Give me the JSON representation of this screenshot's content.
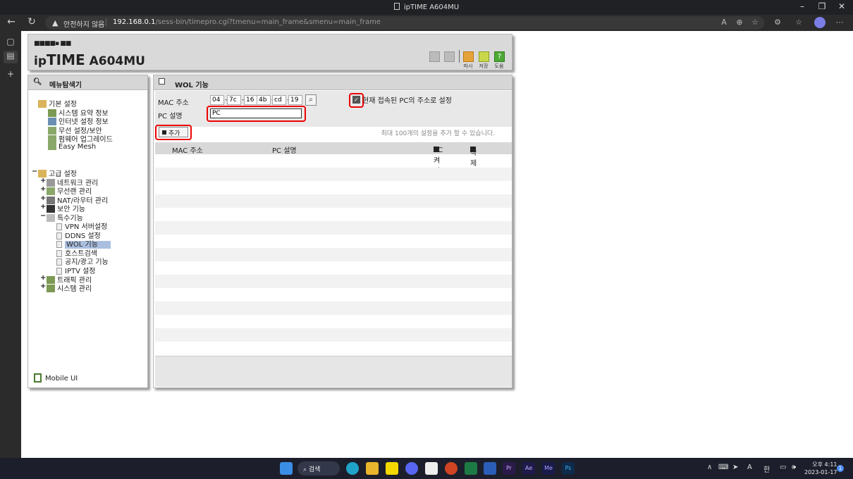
{
  "browser": {
    "title": "ipTIME A604MU",
    "security_label": "안전하지 않음",
    "url_host": "192.168.0.1",
    "url_path": "/sess-bin/timepro.cgi?tmenu=main_frame&smenu=main_frame"
  },
  "header": {
    "logo_prefix": "ip",
    "logo_brand": "TIME",
    "logo_model": "A604MU",
    "actions": [
      {
        "label": "",
        "icon": "home-icon"
      },
      {
        "label": "",
        "icon": "logout-icon"
      },
      {
        "label": "마시",
        "icon": "restart-icon"
      },
      {
        "label": "저장",
        "icon": "save-icon"
      },
      {
        "label": "도움",
        "icon": "help-icon"
      }
    ]
  },
  "menu": {
    "title": "메뉴탐색기",
    "basic": {
      "label": "기본 설정",
      "items": [
        "시스템 요약 정보",
        "인터넷 설정 정보",
        "무선 설정/보안",
        "펌웨어 업그레이드",
        "Easy Mesh"
      ]
    },
    "advanced": {
      "label": "고급 설정",
      "groups": [
        "네트워크 관리",
        "무선랜 관리",
        "NAT/라우터 관리",
        "보안 기능",
        "특수기능"
      ],
      "special_items": [
        "VPN 서버설정",
        "DDNS 설정",
        "WOL 기능",
        "호스트검색",
        "공지/광고 기능",
        "IPTV 설정"
      ],
      "tail_groups": [
        "트래픽 관리",
        "시스템 관리"
      ]
    },
    "mobile_label": "Mobile UI"
  },
  "wol": {
    "title": "WOL 기능",
    "mac_label": "MAC 주소",
    "mac_segments": [
      "04",
      "7c",
      "16",
      "4b",
      "cd",
      "19"
    ],
    "use_current_pc_label": "현재 접속된 PC의 주소로 설정",
    "use_current_pc_checked": true,
    "pc_desc_label": "PC 설명",
    "pc_desc_value": "PC",
    "add_button": "추가",
    "limit_text": "최대 100개의 설정을 추가 할 수 있습니다.",
    "table_headers": {
      "mac": "MAC 주소",
      "pc": "PC 설명",
      "wake": "PC 켜기",
      "delete": "삭제"
    }
  },
  "taskbar": {
    "search_label": "검색",
    "apps": [
      "start-icon",
      "edge-icon",
      "explorer-icon",
      "kakaotalk-icon",
      "discord-icon",
      "notion-icon",
      "powerpoint-icon",
      "excel-icon",
      "word-icon",
      "premiere-icon",
      "aftereffects-icon",
      "mediaencoder-icon",
      "photoshop-icon"
    ],
    "ime_labels": [
      "A",
      "한"
    ],
    "time": "오후 4:11",
    "date": "2023-01-17",
    "notification_count": "1"
  },
  "colors": {
    "highlight": "#ee0000",
    "selected_menu": "#aabfe0",
    "taskbar": "#1c1f2b"
  }
}
